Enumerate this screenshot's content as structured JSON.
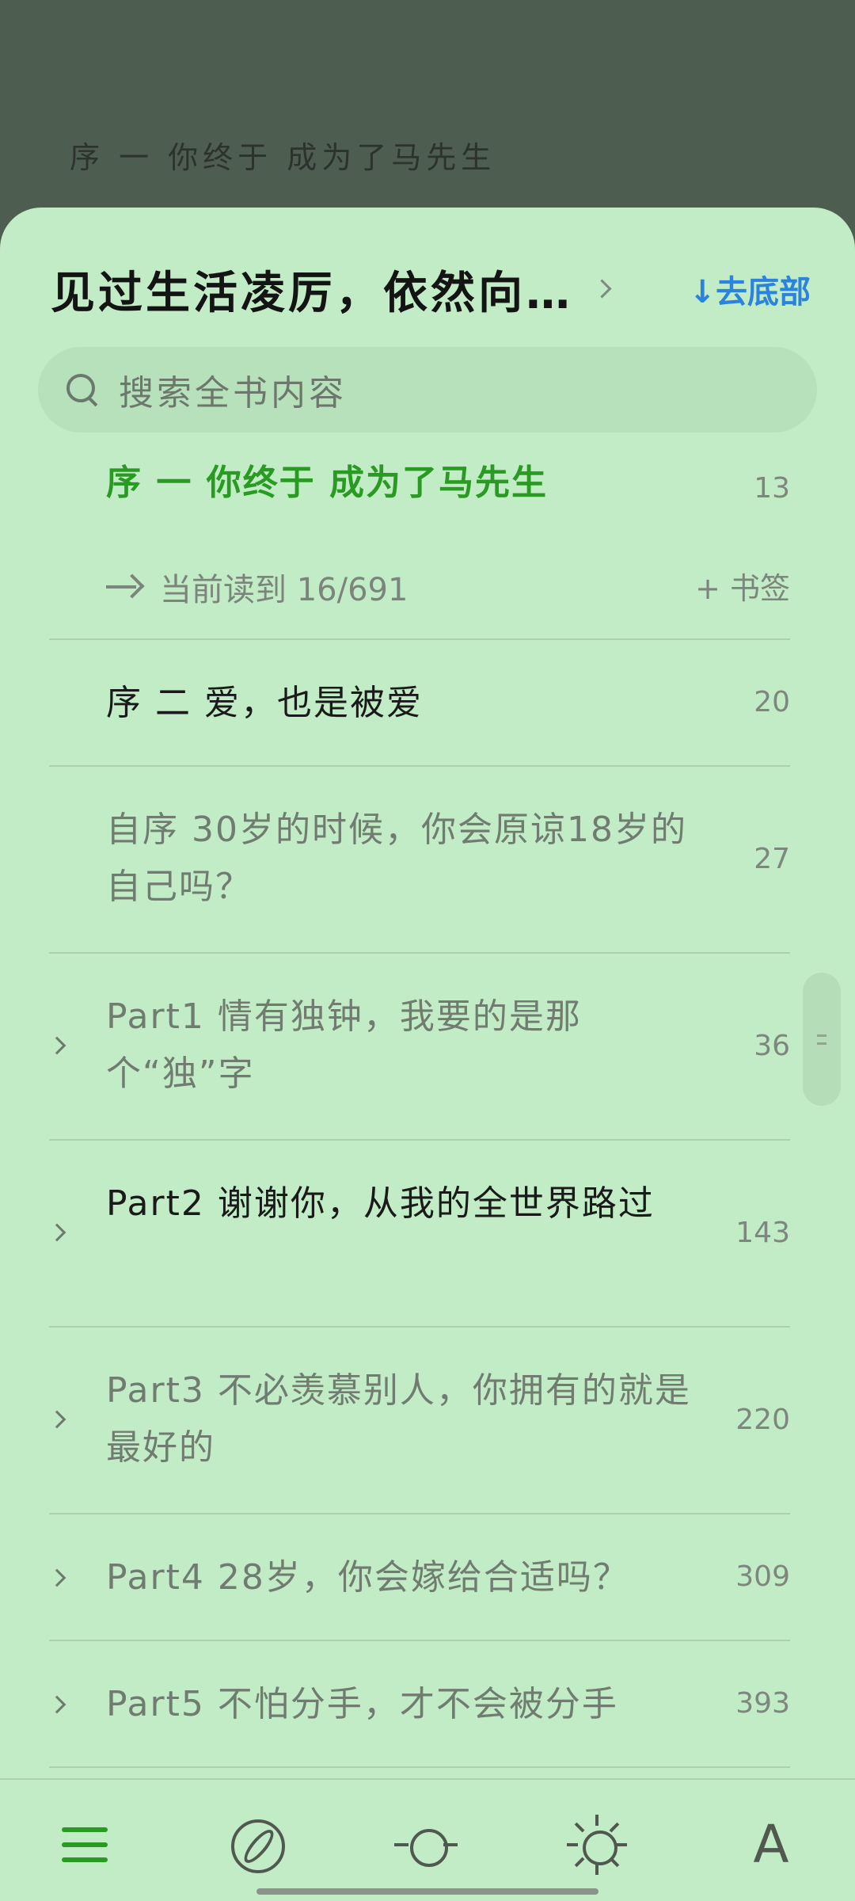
{
  "background": {
    "chapter_title": "序 一 你终于 成为了马先生"
  },
  "header": {
    "book_title": "见过生活凌厉，依然向…",
    "to_bottom": "↓去底部"
  },
  "search": {
    "placeholder": "搜索全书内容"
  },
  "current": {
    "title": "序 一 你终于 成为了马先生",
    "page": "13",
    "progress_label": "当前读到 16/691",
    "bookmark_label": "+ 书签"
  },
  "chapters": [
    {
      "title": "序 二 爱，也是被爱",
      "page": "20"
    },
    {
      "title": "自序 30岁的时候，你会原谅18岁的自己吗？",
      "page": "27"
    },
    {
      "title": "Part1 情有独钟，我要的是那个“独”字",
      "page": "36"
    },
    {
      "title": "Part2 谢谢你，从我的全世界路过",
      "page": "143"
    },
    {
      "title": "Part3 不必羡慕别人，你拥有的就是最好的",
      "page": "220"
    },
    {
      "title": "Part4 28岁，你会嫁给合适吗？",
      "page": "309"
    },
    {
      "title": "Part5 不怕分手，才不会被分手",
      "page": "393"
    }
  ],
  "bottom_nav": {
    "font_label": "A"
  },
  "colors": {
    "sheet_bg": "#c1ecc5",
    "accent": "#2a9b22",
    "link": "#2a83e0"
  }
}
